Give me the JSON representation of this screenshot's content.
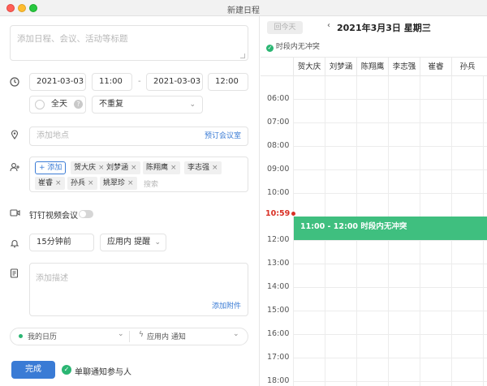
{
  "window": {
    "title": "新建日程"
  },
  "form": {
    "title_placeholder": "添加日程、会议、活动等标题",
    "start_date": "2021-03-03",
    "start_time": "11:00",
    "end_date": "2021-03-03",
    "end_time": "12:00",
    "all_day_label": "全天",
    "repeat_value": "不重复",
    "location_placeholder": "添加地点",
    "book_room_link": "预订会议室",
    "add_participant_label": "+ 添加",
    "participants": [
      "贺大庆",
      "刘梦涵",
      "陈翔鹰",
      "李志强",
      "崔睿",
      "孙兵",
      "姚翠珍"
    ],
    "participant_search_placeholder": "搜索",
    "video_meeting_label": "钉钉视频会议",
    "reminder_time": "15分钟前",
    "reminder_method": "应用内 提醒",
    "description_placeholder": "添加描述",
    "add_attachment_link": "添加附件",
    "calendar_value": "我的日历",
    "notify_value": "应用内 通知",
    "done_button": "完成",
    "chat_notify_label": "单聊通知参与人"
  },
  "calendar": {
    "today_button": "回今天",
    "date_title": "2021年3月3日 星期三",
    "conflict_status": "时段内无冲突",
    "columns": [
      "贺大庆",
      "刘梦涵",
      "陈翔鹰",
      "李志强",
      "崔睿",
      "孙兵"
    ],
    "hours": [
      "06:00",
      "07:00",
      "08:00",
      "09:00",
      "10:00",
      "11:00",
      "12:00",
      "13:00",
      "14:00",
      "15:00",
      "16:00",
      "17:00",
      "18:00"
    ],
    "now_time": "10:59",
    "event_text": "11:00 - 12:00 时段内无冲突",
    "colors": {
      "event": "#3fbf7f",
      "now": "#d93025",
      "accent": "#3a7bd5"
    }
  }
}
